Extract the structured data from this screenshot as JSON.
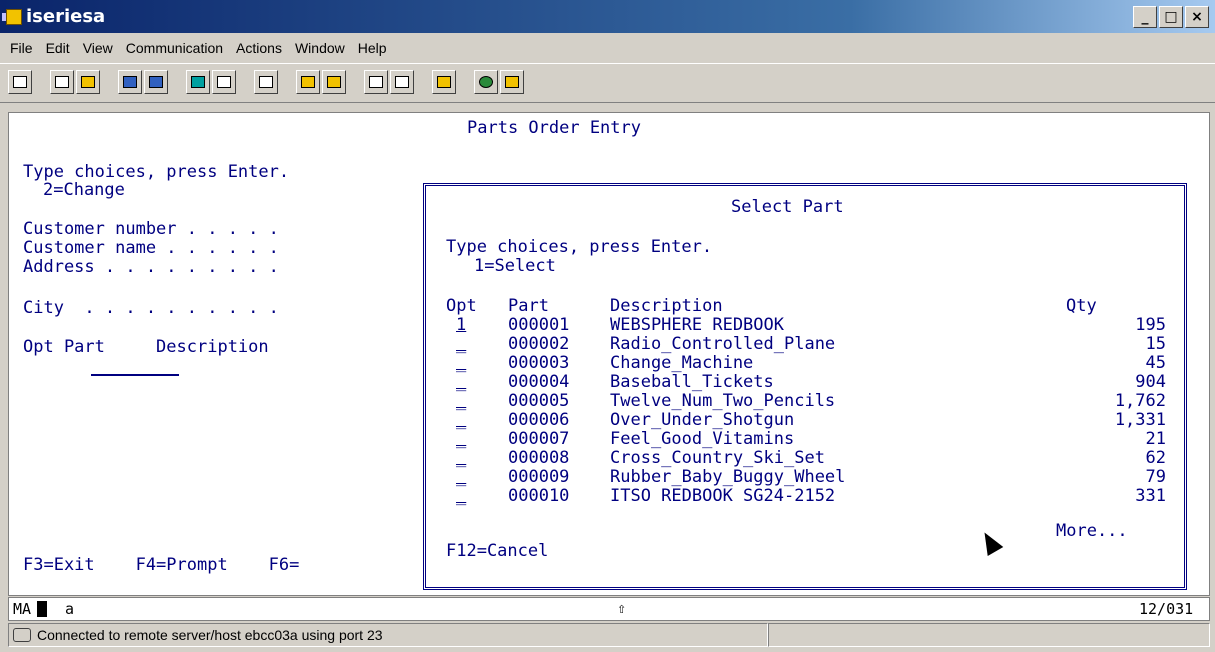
{
  "window": {
    "title": "iseriesa"
  },
  "menu": [
    "File",
    "Edit",
    "View",
    "Communication",
    "Actions",
    "Window",
    "Help"
  ],
  "screen": {
    "heading": "Parts Order Entry",
    "instructions": "Type choices, press Enter.",
    "option": "2=Change",
    "fields": [
      "Customer number . . . . .",
      "Customer name . . . . . .",
      "Address . . . . . . . . .",
      "City  . . . . . . . . . ."
    ],
    "list_header": "Opt Part     Description",
    "fkeys": "F3=Exit    F4=Prompt    F6="
  },
  "popup": {
    "title": "Select Part",
    "instructions": "Type choices, press Enter.",
    "option": "1=Select",
    "col_opt": "Opt",
    "col_part": "Part",
    "col_desc": "Description",
    "col_qty": "Qty",
    "rows": [
      {
        "opt": "1",
        "part": "000001",
        "desc": "WEBSPHERE REDBOOK",
        "qty": "195"
      },
      {
        "opt": "_",
        "part": "000002",
        "desc": "Radio_Controlled_Plane",
        "qty": "15"
      },
      {
        "opt": "_",
        "part": "000003",
        "desc": "Change_Machine",
        "qty": "45"
      },
      {
        "opt": "_",
        "part": "000004",
        "desc": "Baseball_Tickets",
        "qty": "904"
      },
      {
        "opt": "_",
        "part": "000005",
        "desc": "Twelve_Num_Two_Pencils",
        "qty": "1,762"
      },
      {
        "opt": "_",
        "part": "000006",
        "desc": "Over_Under_Shotgun",
        "qty": "1,331"
      },
      {
        "opt": "_",
        "part": "000007",
        "desc": "Feel_Good_Vitamins",
        "qty": "21"
      },
      {
        "opt": "_",
        "part": "000008",
        "desc": "Cross_Country_Ski_Set",
        "qty": "62"
      },
      {
        "opt": "_",
        "part": "000009",
        "desc": "Rubber_Baby_Buggy_Wheel",
        "qty": "79"
      },
      {
        "opt": "_",
        "part": "000010",
        "desc": "ITSO REDBOOK SG24-2152",
        "qty": "331"
      }
    ],
    "more": "More...",
    "fkeys": "F12=Cancel"
  },
  "oia": {
    "mode": "MA",
    "field": "a",
    "shift_symbol": "⇧",
    "position": "12/031"
  },
  "statusbar": {
    "message": "Connected to remote server/host ebcc03a using port 23"
  },
  "colors": {
    "screen_text": "#000080",
    "titlebar": "#0a246a"
  }
}
